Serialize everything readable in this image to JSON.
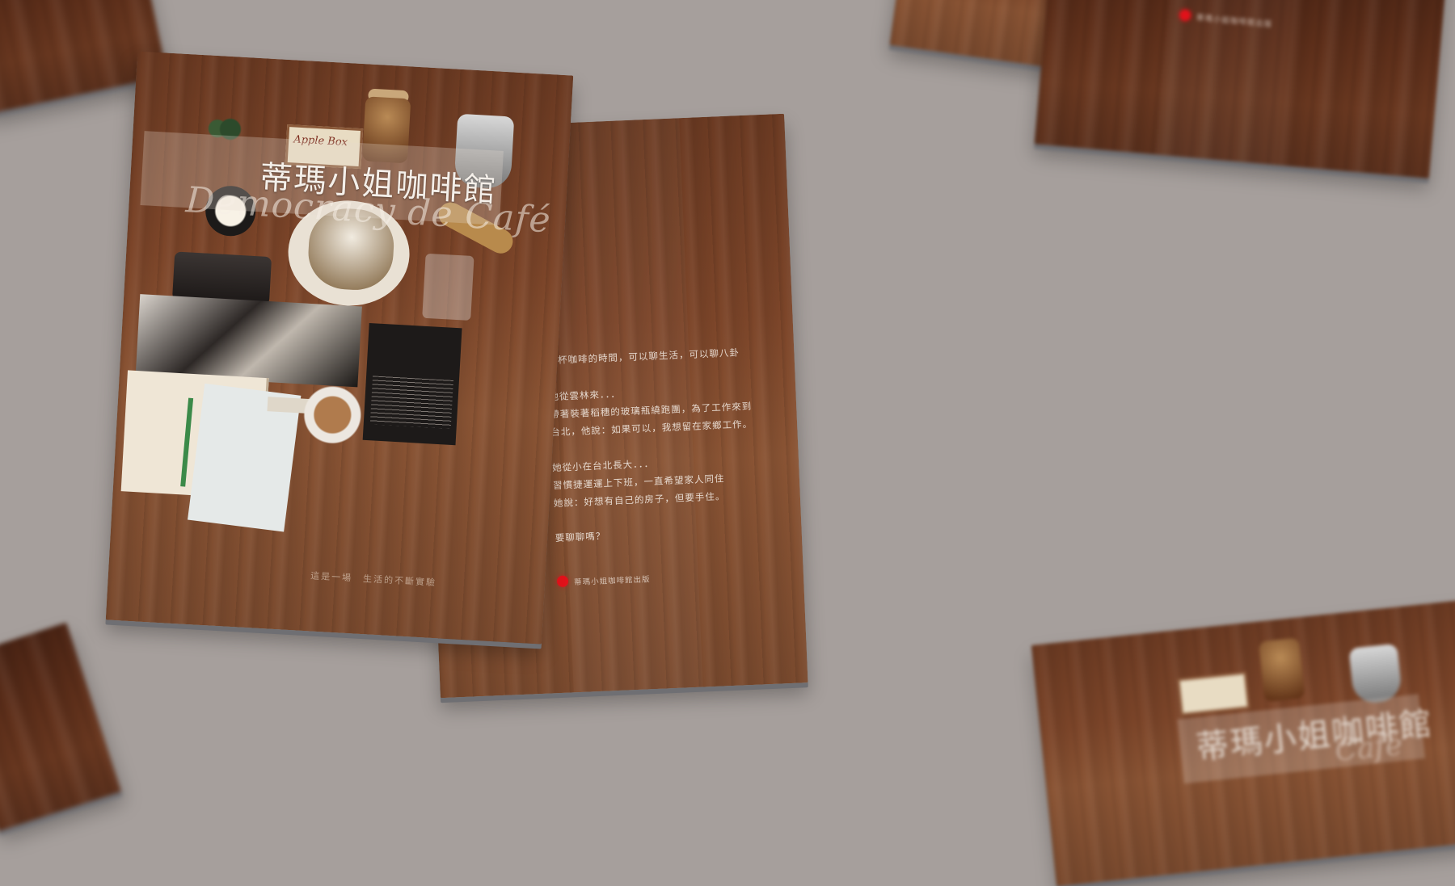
{
  "front_cover": {
    "title_cn": "蒂瑪小姐咖啡館",
    "title_en": "Democracy de Café",
    "slogan": "這是一場　生活的不斷實驗",
    "apple_label": "Apple Box"
  },
  "back_cover": {
    "lines": [
      "一杯咖啡的時間，可以聊生活，可以聊八卦",
      "他從雲林來．．．",
      "帶著裝著稻穗的玻璃瓶繞跑團，為了工作來到",
      "台北，他說：如果可以，我想留在家鄉工作。",
      "她從小在台北長大．．．",
      "習慣捷運運上下班，一直希望家人同住",
      "她說：好想有自己的房子，但要手住。",
      "要聊聊嗎？"
    ],
    "publisher": "蒂瑪小姐咖啡館出版"
  },
  "top_right_mag": {
    "publisher": "蒂瑪小姐咖啡館出版"
  },
  "bottom_right_mag": {
    "title_cn": "蒂瑪小姐咖啡館",
    "title_en": "Café"
  },
  "colors": {
    "background": "#a69f9c",
    "accent_red": "#e1121a"
  }
}
